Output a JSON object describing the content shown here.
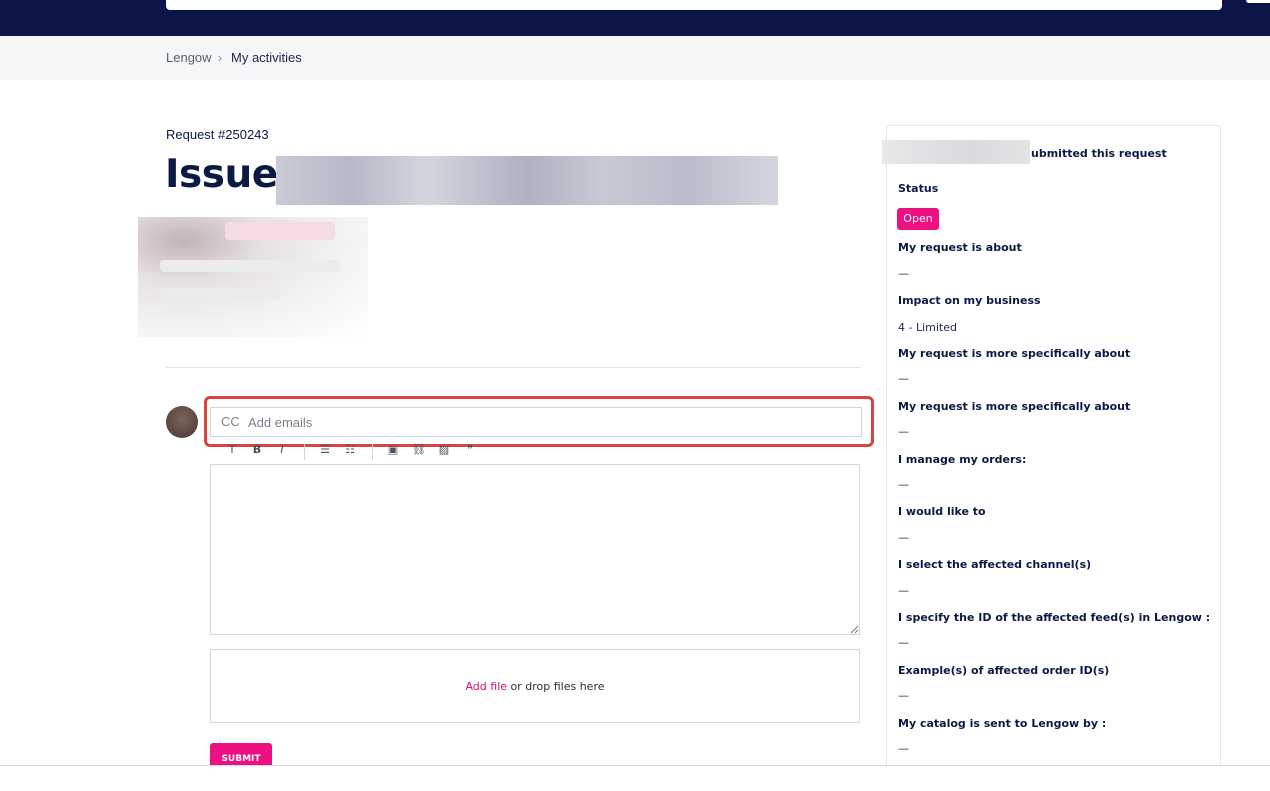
{
  "breadcrumb": {
    "root": "Lengow",
    "separator": "›",
    "current": "My activities"
  },
  "request": {
    "id_label": "Request #250243",
    "title": "Issue"
  },
  "comment": {
    "cc_label": "CC",
    "cc_placeholder": "Add emails",
    "toolbar": [
      {
        "name": "text-format-icon",
        "glyph": "T"
      },
      {
        "name": "bold-icon",
        "glyph": "B"
      },
      {
        "name": "italic-icon",
        "glyph": "I"
      },
      {
        "name": "bullet-list-icon",
        "glyph": "☰"
      },
      {
        "name": "numbered-list-icon",
        "glyph": "☷"
      },
      {
        "name": "code-block-icon",
        "glyph": "▣"
      },
      {
        "name": "link-icon",
        "glyph": "⛓"
      },
      {
        "name": "image-icon",
        "glyph": "▨"
      },
      {
        "name": "quote-icon",
        "glyph": "❞"
      }
    ],
    "dropzone_link": "Add file",
    "dropzone_text": " or drop files here",
    "submit_label": "SUBMIT"
  },
  "sidebar": {
    "submitted_text": "ubmitted this request",
    "status_label": "Status",
    "status_value": "Open",
    "fields": [
      {
        "label": "My request is about",
        "value": "—"
      },
      {
        "label": "Impact on my business",
        "value": "4 - Limited"
      },
      {
        "label": "My request is more specifically about",
        "value": "—"
      },
      {
        "label": "My request is more specifically about",
        "value": "—"
      },
      {
        "label": "I manage my orders:",
        "value": "—"
      },
      {
        "label": "I would like to",
        "value": "—"
      },
      {
        "label": "I select the affected channel(s)",
        "value": "—"
      },
      {
        "label": "I specify the ID of the affected feed(s) in Lengow :",
        "value": "—"
      },
      {
        "label": "Example(s) of affected order ID(s)",
        "value": "—"
      },
      {
        "label": "My catalog is sent to Lengow by :",
        "value": "—"
      }
    ]
  },
  "colors": {
    "navy": "#0b1647",
    "accent": "#ec1082",
    "highlight": "#d9443f"
  }
}
